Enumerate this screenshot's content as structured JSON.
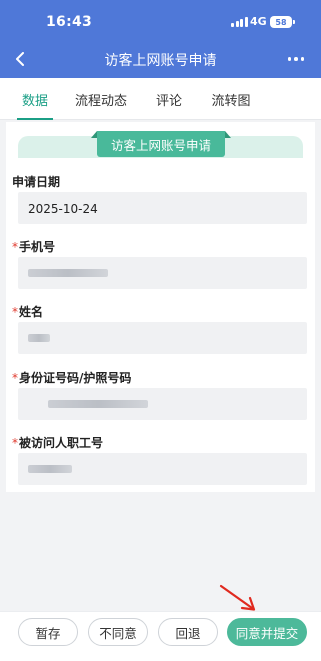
{
  "status_bar": {
    "time": "16:43",
    "network": "4G",
    "battery": "58"
  },
  "nav": {
    "title": "访客上网账号申请"
  },
  "tabs": [
    {
      "label": "数据",
      "active": true
    },
    {
      "label": "流程动态",
      "active": false
    },
    {
      "label": "评论",
      "active": false
    },
    {
      "label": "流转图",
      "active": false
    }
  ],
  "form": {
    "banner": "访客上网账号申请",
    "fields": [
      {
        "label": "申请日期",
        "required": false,
        "value": "2025-10-24"
      },
      {
        "label": "手机号",
        "required": true,
        "value": ""
      },
      {
        "label": "姓名",
        "required": true,
        "value": ""
      },
      {
        "label": "身份证号码/护照号码",
        "required": true,
        "value": ""
      },
      {
        "label": "被访问人职工号",
        "required": true,
        "value": ""
      }
    ],
    "required_mark": "*"
  },
  "actions": {
    "save": "暂存",
    "disagree": "不同意",
    "return": "回退",
    "agree_submit": "同意并提交"
  },
  "colors": {
    "nav_blue": "#4f78d8",
    "accent_green": "#4db99a",
    "required_red": "#e03b2f"
  }
}
